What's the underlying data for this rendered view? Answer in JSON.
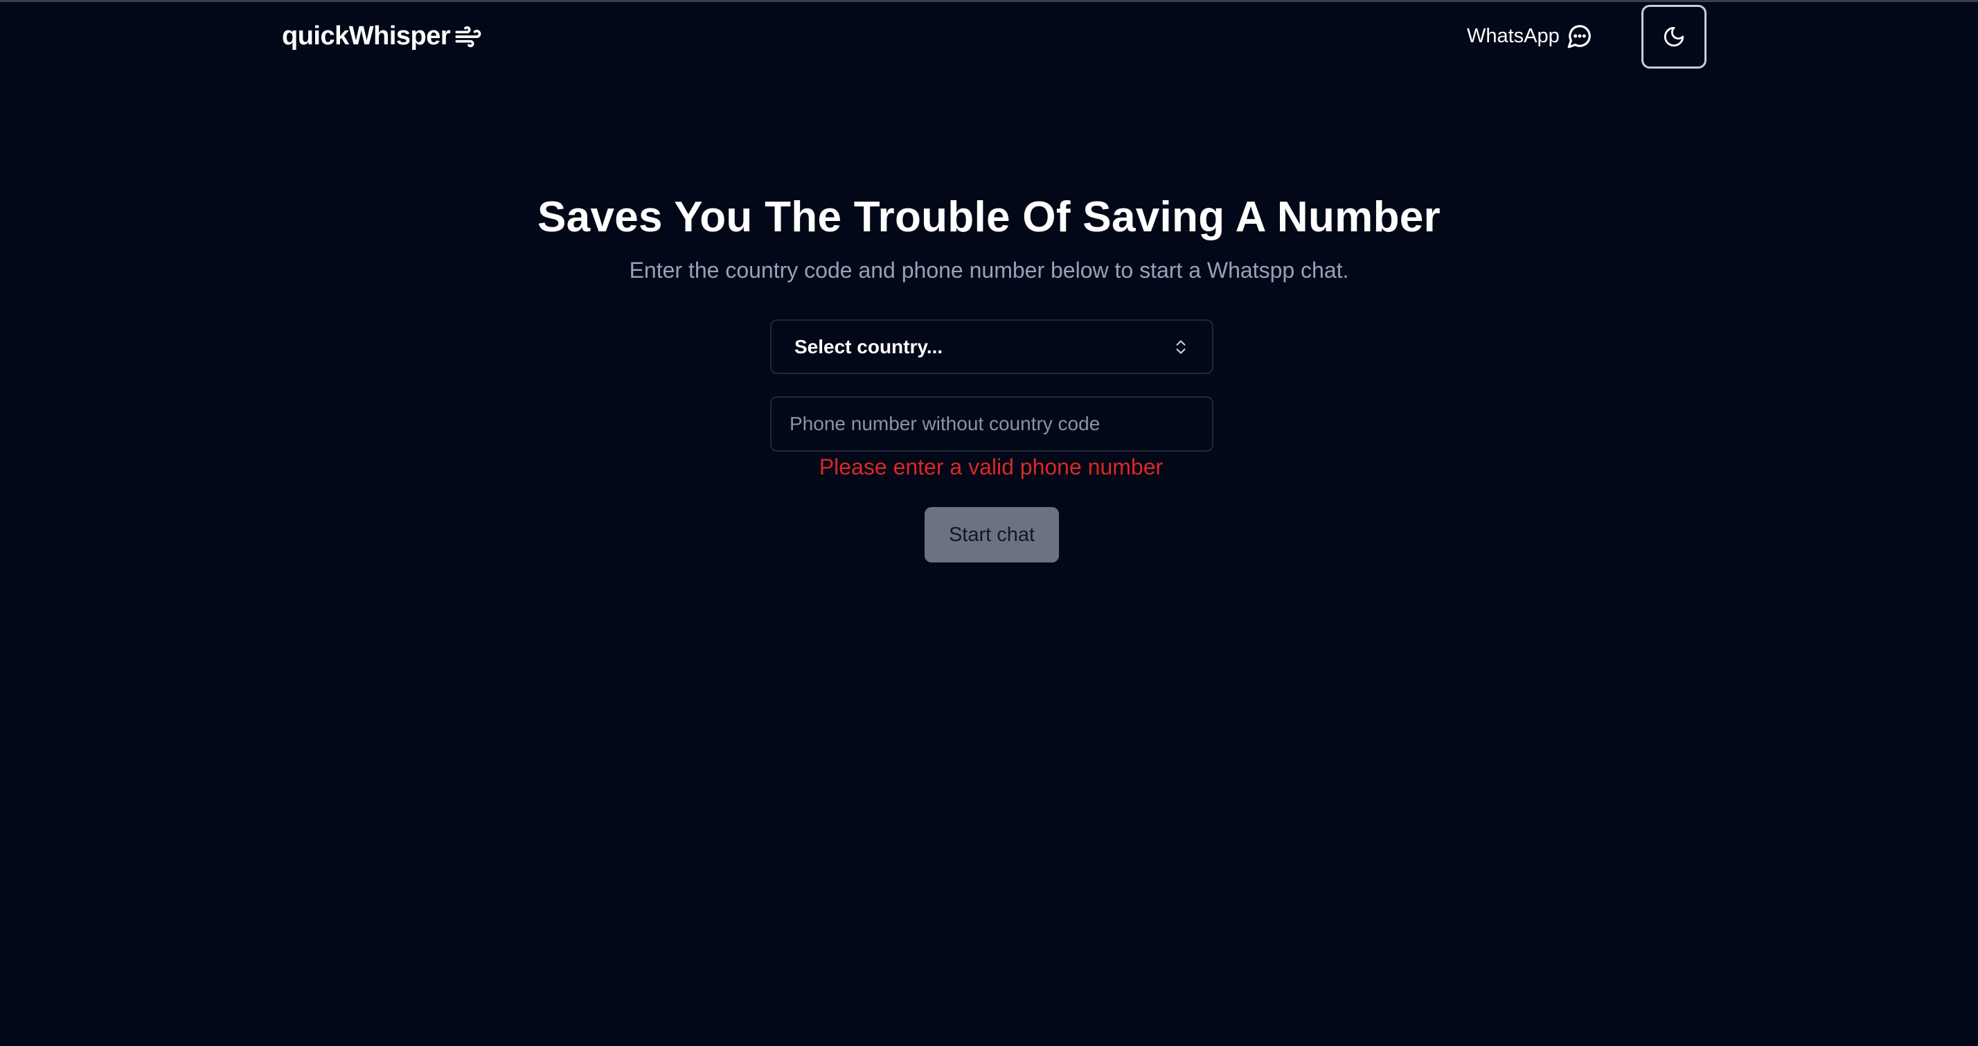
{
  "header": {
    "logo_text": "quickWhisper",
    "logo_icon": "wind-icon",
    "whatsapp_label": "WhatsApp",
    "whatsapp_icon": "message-circle-icon",
    "theme_icon": "moon-icon"
  },
  "main": {
    "title": "Saves You The Trouble Of Saving A Number",
    "subtitle": "Enter the country code and phone number below to start a Whatspp chat.",
    "country_select": {
      "selected": "Select country...",
      "icon": "chevrons-up-down-icon"
    },
    "phone_input": {
      "value": "",
      "placeholder": "Phone number without country code"
    },
    "error_message": "Please enter a valid phone number",
    "start_button": "Start chat"
  },
  "colors": {
    "background": "#020817",
    "error": "#dc2626",
    "button_disabled": "#6b7280",
    "muted_text": "#94a3b8"
  }
}
